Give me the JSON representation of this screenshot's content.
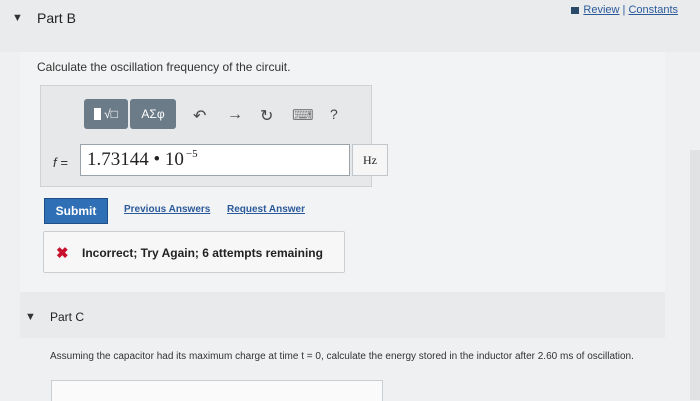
{
  "review_link": {
    "review": "Review",
    "separator": " | ",
    "constants": "Constants"
  },
  "part_b": {
    "title": "Part B",
    "question": "Calculate the oscillation frequency of the circuit.",
    "toolbar": {
      "template_label": "√□",
      "greek_label": "ΑΣφ",
      "undo": "↶",
      "redo": "→",
      "reset": "↻",
      "keyboard": "⌨",
      "help": "?"
    },
    "variable_label": "f =",
    "answer_value": "1.73144 • 10",
    "answer_exponent": "−5",
    "unit": "Hz",
    "submit_label": "Submit",
    "previous_answers": "Previous Answers",
    "request_answer": "Request Answer",
    "feedback": "Incorrect; Try Again; 6 attempts remaining"
  },
  "part_c": {
    "title": "Part C",
    "question": "Assuming the capacitor had its maximum charge at time t = 0, calculate the energy stored in the inductor after 2.60 ms of oscillation."
  },
  "colors": {
    "submit": "#2f6fb6",
    "error": "#c8102e",
    "link": "#2a5a9a",
    "tool_button": "#6c7b88"
  }
}
